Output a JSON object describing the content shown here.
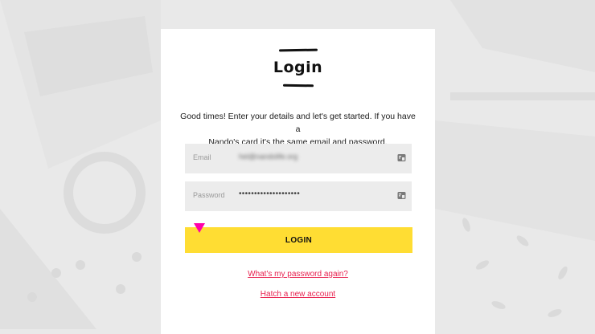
{
  "header": {
    "title": "Login"
  },
  "intro": {
    "line1": "Good times! Enter your details and let's get started. If you have a",
    "line2": "Nando's card it's the same email and password."
  },
  "form": {
    "email": {
      "label": "Email",
      "value": "hel@nandolife.org"
    },
    "password": {
      "label": "Password",
      "value": "••••••••••••••••••••"
    },
    "submit_label": "LOGIN"
  },
  "links": {
    "forgot_password": "What's my password again?",
    "create_account": "Hatch a new account"
  },
  "colors": {
    "accent": "#ffdd33",
    "link": "#e8214f",
    "cursor": "#ff00aa",
    "background": "#e9e9e9"
  },
  "icons": {
    "field_icon": "keychain-icon",
    "pointer": "cursor-marker"
  }
}
